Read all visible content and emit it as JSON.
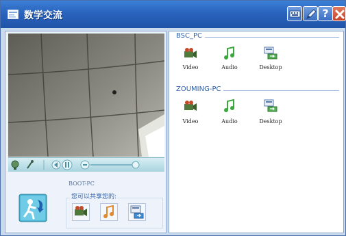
{
  "window": {
    "title": "数学交流"
  },
  "local": {
    "name": "BOOT-PC",
    "share_label": "您可以共享您的:"
  },
  "groups": [
    {
      "name": "BSC_PC",
      "items": [
        {
          "label": "Video"
        },
        {
          "label": "Audio"
        },
        {
          "label": "Desktop"
        }
      ]
    },
    {
      "name": "ZOUMING-PC",
      "items": [
        {
          "label": "Video"
        },
        {
          "label": "Audio"
        },
        {
          "label": "Desktop"
        }
      ]
    }
  ],
  "colors": {
    "titlebar": "#2a63bd",
    "close": "#c8442a",
    "panel_border": "#8fa7cc",
    "group_label": "#2e5ea8"
  },
  "icons": [
    "window-icon",
    "keyboard-icon",
    "pen-icon",
    "help-icon",
    "close-icon",
    "video-camera-icon",
    "music-note-icon",
    "desktop-share-icon",
    "user-avatar-icon"
  ]
}
